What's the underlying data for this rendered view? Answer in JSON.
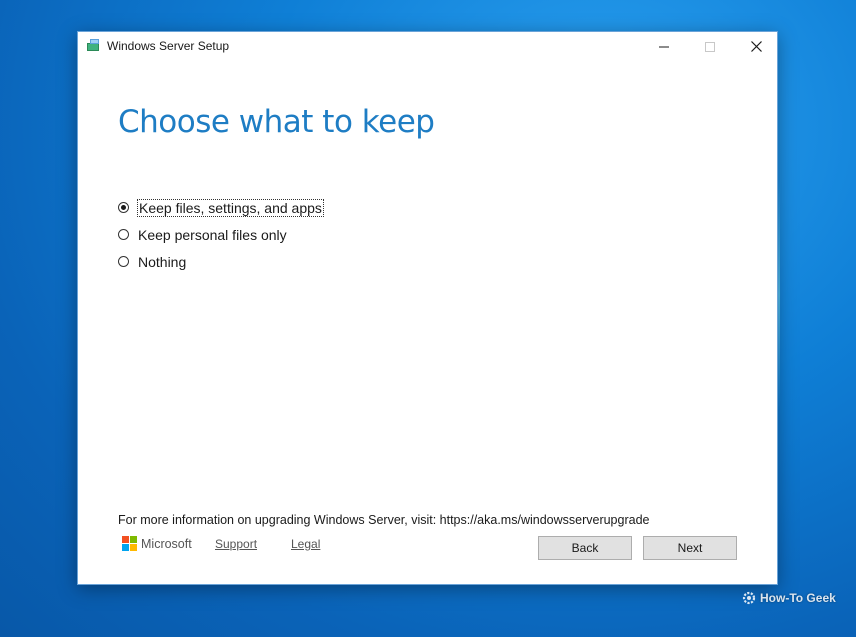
{
  "window": {
    "title": "Windows Server Setup",
    "controls": {
      "minimize": "minimize-icon",
      "maximize": "maximize-icon",
      "close": "close-icon"
    }
  },
  "page": {
    "heading": "Choose what to keep",
    "options": [
      {
        "label": "Keep files, settings, and apps",
        "selected": true
      },
      {
        "label": "Keep personal files only",
        "selected": false
      },
      {
        "label": "Nothing",
        "selected": false
      }
    ]
  },
  "footer": {
    "info": "For more information on upgrading Windows Server, visit: https://aka.ms/windowsserverupgrade",
    "brand": "Microsoft",
    "support_label": "Support",
    "legal_label": "Legal",
    "back_label": "Back",
    "next_label": "Next"
  },
  "watermark": {
    "text": "How-To Geek"
  },
  "colors": {
    "heading": "#1e7dc4",
    "ms_red": "#f25022",
    "ms_green": "#7fba00",
    "ms_blue": "#00a4ef",
    "ms_yellow": "#ffb900"
  }
}
